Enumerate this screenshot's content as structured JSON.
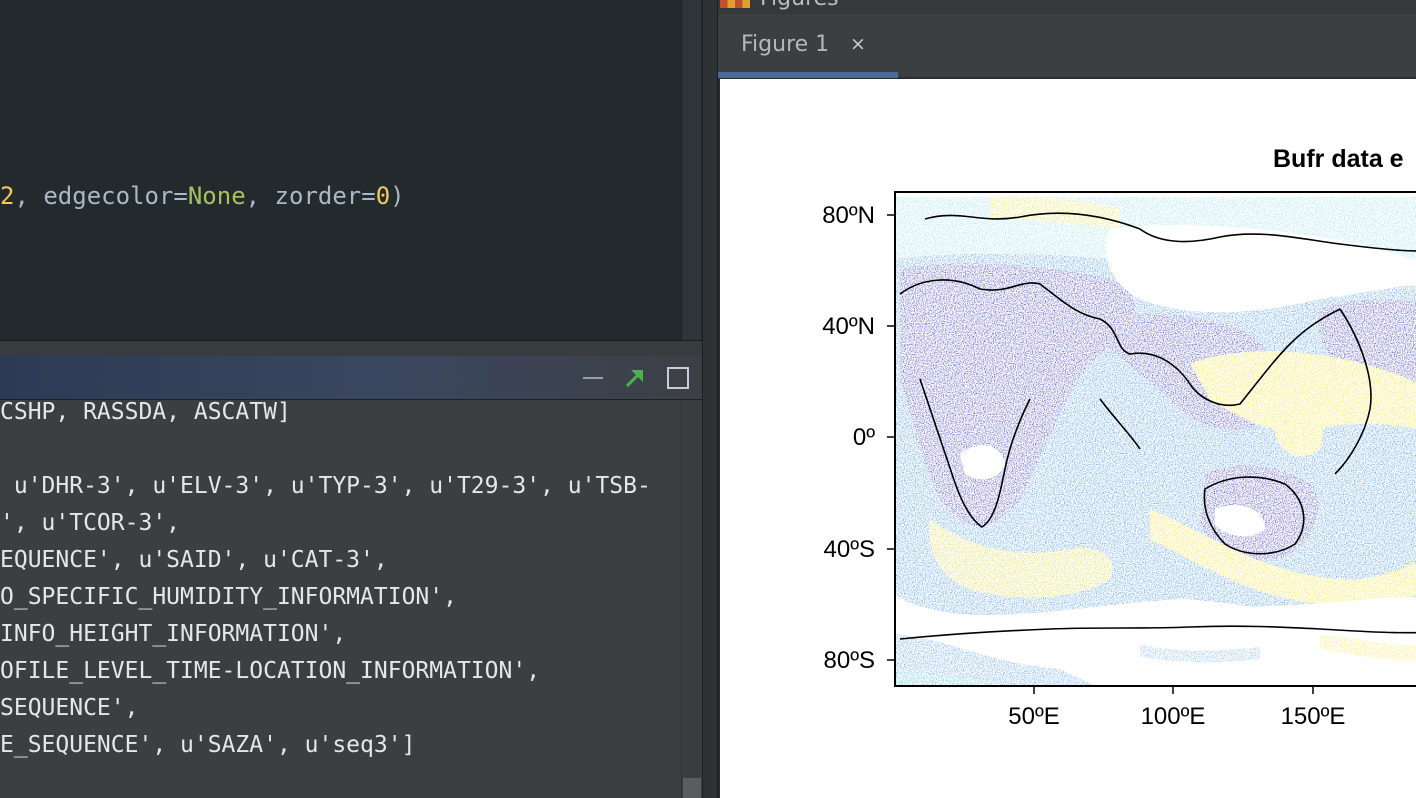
{
  "editor": {
    "code_tokens": [
      {
        "text": "2",
        "cls": "tok-num"
      },
      {
        "text": ", edgecolor=",
        "cls": "tok-p"
      },
      {
        "text": "None",
        "cls": "tok-kw"
      },
      {
        "text": ", zorder=",
        "cls": "tok-p"
      },
      {
        "text": "0",
        "cls": "tok-num"
      },
      {
        "text": ")",
        "cls": "tok-p"
      }
    ]
  },
  "console": {
    "lines": [
      "CSHP, RASSDA, ASCATW]",
      "",
      " u'DHR-3', u'ELV-3', u'TYP-3', u'T29-3', u'TSB-",
      "', u'TCOR-3',",
      "EQUENCE', u'SAID', u'CAT-3',",
      "O_SPECIFIC_HUMIDITY_INFORMATION',",
      "INFO_HEIGHT_INFORMATION',",
      "OFILE_LEVEL_TIME-LOCATION_INFORMATION',",
      "SEQUENCE',",
      "E_SEQUENCE', u'SAZA', u'seq3']"
    ]
  },
  "figures": {
    "pane_title": "Figures",
    "tab_label": "Figure 1",
    "tab_close": "×",
    "plot_title": "Bufr data e",
    "y_ticks": [
      "80ºN",
      "40ºN",
      "0º",
      "40ºS",
      "80ºS"
    ],
    "x_ticks": [
      "50ºE",
      "100ºE",
      "150ºE"
    ]
  },
  "colors": {
    "accent_tab": "#4a6a94",
    "detach_arrow": "#4caf50",
    "map_low": "#2b2fb8",
    "map_mid": "#3d8ee8",
    "map_cyan": "#3cc0d8",
    "map_high": "#f2e21c"
  }
}
